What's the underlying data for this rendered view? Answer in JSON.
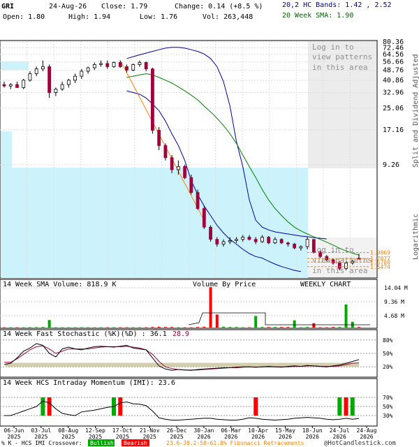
{
  "header": {
    "symbol": "GRI",
    "date": "24-Aug-26",
    "close_label": "Close: 1.79",
    "change_label": "Change: 0.14 (+8.5 %)",
    "open_label": "Open: 1.80",
    "high_label": "High: 1.94",
    "low_label": "Low: 1.76",
    "vol_label": "Vol: 263,448",
    "bands_label": "20,2 HC Bands: 1.42 , 2.52",
    "sma_label": "20 Week SMA: 1.90"
  },
  "watermark": [
    "Log in to",
    "view patterns",
    "in this area"
  ],
  "right_labels": {
    "split": "Split and Dividend Adjusted",
    "log": "Logarithmic"
  },
  "price_ticks": [
    "80.36",
    "72.46",
    "64.56",
    "56.66",
    "48.76",
    "40.86",
    "32.96",
    "25.06",
    "17.16",
    "9.26"
  ],
  "fib_labels": [
    "1.9869",
    "1.7877",
    "1.6760",
    "1.5474"
  ],
  "volume_panel": {
    "title": "14 Week SMA Volume: 818.9 K",
    "vbp": "Volume By Price",
    "weekly": "WEEKLY CHART",
    "ticks": [
      "14.04 M",
      "9.36 M",
      "4.68 M"
    ]
  },
  "stoch_panel": {
    "title": "14 Week Fast Stochastic (%K)(%D) : 36.1",
    "d_value": "28.9",
    "ticks": [
      "80%",
      "50%",
      "20%"
    ]
  },
  "imi_panel": {
    "title": "14 Week HCS Intraday Momentum (IMI): 23.6",
    "ticks": [
      "70%",
      "50%",
      "30%"
    ]
  },
  "x_labels": [
    [
      "06-Jun",
      "2025"
    ],
    [
      "03-Jul",
      "2025"
    ],
    [
      "08-Aug",
      "2025"
    ],
    [
      "12-Sep",
      "2025"
    ],
    [
      "17-Oct",
      "2025"
    ],
    [
      "21-Nov",
      "2025"
    ],
    [
      "26-Dec",
      "2025"
    ],
    [
      "30-Jan",
      "2026"
    ],
    [
      "06-Mar",
      "2026"
    ],
    [
      "10-Apr",
      "2026"
    ],
    [
      "15-May",
      "2026"
    ],
    [
      "18-Jun",
      "2026"
    ],
    [
      "24-Jul",
      "2026"
    ],
    [
      "24-Aug",
      "2026"
    ]
  ],
  "footer": {
    "prefix": "% K - HCS IMI Crossover:",
    "bullish": "Bullish",
    "bearish": "Bearish",
    "fib": "23.6-38.2-50-61.8% Fibonacci Retracements",
    "copyright": "@HotCandlestick.com"
  },
  "colors": {
    "up": "#ffffff",
    "down": "#a0003c",
    "sma": "#008000",
    "bands": "#0000aa",
    "fib": "#ff8000",
    "cyan": "#ccf3fb",
    "vol_red": "#ff0000",
    "vol_green": "#00aa00"
  },
  "chart_data": {
    "type": "candlestick",
    "scale": "log",
    "ylim": [
      1.3,
      80.36
    ],
    "candles": [
      [
        38,
        40,
        36,
        37
      ],
      [
        37,
        39,
        35,
        38
      ],
      [
        38,
        40,
        36,
        36
      ],
      [
        36,
        42,
        35,
        41
      ],
      [
        41,
        48,
        40,
        46
      ],
      [
        46,
        52,
        44,
        50
      ],
      [
        50,
        58,
        48,
        52
      ],
      [
        52,
        54,
        30,
        33
      ],
      [
        33,
        36,
        31,
        35
      ],
      [
        35,
        40,
        34,
        38
      ],
      [
        38,
        42,
        36,
        41
      ],
      [
        41,
        46,
        39,
        44
      ],
      [
        44,
        50,
        42,
        48
      ],
      [
        48,
        52,
        46,
        51
      ],
      [
        51,
        56,
        49,
        54
      ],
      [
        54,
        58,
        52,
        55
      ],
      [
        55,
        58,
        50,
        52
      ],
      [
        52,
        57,
        51,
        56
      ],
      [
        56,
        58,
        51,
        52
      ],
      [
        52,
        54,
        47,
        49
      ],
      [
        49,
        55,
        48,
        54
      ],
      [
        54,
        58,
        52,
        56
      ],
      [
        56,
        57,
        48,
        50
      ],
      [
        50,
        51,
        16,
        17
      ],
      [
        17,
        18,
        12,
        13
      ],
      [
        13,
        13.5,
        10,
        10.5
      ],
      [
        10.5,
        11,
        8,
        8.5
      ],
      [
        8.5,
        10,
        7.8,
        9
      ],
      [
        9,
        9.3,
        7.2,
        7.4
      ],
      [
        7.4,
        7.8,
        5.5,
        5.7
      ],
      [
        5.7,
        6,
        4.2,
        4.3
      ],
      [
        4.3,
        4.5,
        3.0,
        3.1
      ],
      [
        3.1,
        3.2,
        2.4,
        2.5
      ],
      [
        2.5,
        2.6,
        2.2,
        2.3
      ],
      [
        2.3,
        2.5,
        2.2,
        2.4
      ],
      [
        2.4,
        2.6,
        2.3,
        2.45
      ],
      [
        2.45,
        2.6,
        2.35,
        2.5
      ],
      [
        2.5,
        2.7,
        2.4,
        2.6
      ],
      [
        2.6,
        2.7,
        2.45,
        2.5
      ],
      [
        2.5,
        2.6,
        2.3,
        2.4
      ],
      [
        2.4,
        2.7,
        2.35,
        2.6
      ],
      [
        2.6,
        2.65,
        2.3,
        2.35
      ],
      [
        2.35,
        2.6,
        2.3,
        2.5
      ],
      [
        2.5,
        2.55,
        2.3,
        2.35
      ],
      [
        2.35,
        2.4,
        2.2,
        2.3
      ],
      [
        2.3,
        2.35,
        2.1,
        2.15
      ],
      [
        2.15,
        2.25,
        2.05,
        2.2
      ],
      [
        2.2,
        2.6,
        2.1,
        2.5
      ],
      [
        2.5,
        2.5,
        1.95,
        2.0
      ],
      [
        2.0,
        2.05,
        1.8,
        1.85
      ],
      [
        1.85,
        1.9,
        1.7,
        1.75
      ],
      [
        1.75,
        1.8,
        1.6,
        1.65
      ],
      [
        1.65,
        1.7,
        1.45,
        1.5
      ],
      [
        1.5,
        1.7,
        1.45,
        1.65
      ],
      [
        1.65,
        1.75,
        1.6,
        1.7
      ],
      [
        1.8,
        1.94,
        1.76,
        1.79
      ]
    ],
    "sma20": [
      null,
      null,
      null,
      null,
      null,
      null,
      null,
      null,
      null,
      null,
      null,
      null,
      null,
      null,
      null,
      null,
      null,
      null,
      null,
      43,
      44,
      45,
      46,
      45,
      43,
      41,
      39,
      36.5,
      34,
      31.5,
      29,
      26,
      23.5,
      21,
      18.5,
      16,
      13.5,
      11,
      9,
      7.4,
      6,
      5,
      4.3,
      3.8,
      3.4,
      3.1,
      2.9,
      2.75,
      2.62,
      2.5,
      2.38,
      2.26,
      2.14,
      2.04,
      1.96,
      1.9
    ],
    "upper_band": [
      null,
      null,
      null,
      null,
      null,
      null,
      null,
      null,
      null,
      null,
      null,
      null,
      null,
      null,
      null,
      null,
      null,
      null,
      null,
      60,
      62,
      64,
      66,
      68,
      70,
      72,
      73,
      73,
      72,
      70,
      68,
      65,
      60,
      52,
      40,
      26,
      14,
      9,
      5,
      3.5,
      3.1,
      2.95,
      2.85,
      2.8,
      2.75,
      2.7,
      2.65,
      2.62,
      2.58,
      2.55,
      2.52
    ],
    "lower_band": [
      null,
      null,
      null,
      null,
      null,
      null,
      null,
      null,
      null,
      null,
      null,
      null,
      null,
      null,
      null,
      null,
      null,
      null,
      null,
      34,
      33,
      32,
      30,
      27,
      24,
      20,
      16,
      13,
      10,
      7,
      5.5,
      4.5,
      3.8,
      3.2,
      2.8,
      2.5,
      2.3,
      2.1,
      1.95,
      1.85,
      1.8,
      1.7,
      1.62,
      1.55,
      1.5,
      1.45,
      1.42
    ],
    "volume_red_weeks": [
      39,
      40,
      41,
      48
    ],
    "volume_green_weeks": [
      52,
      53
    ],
    "stoch_k": [
      25,
      28,
      40,
      55,
      62,
      72,
      68,
      50,
      42,
      60,
      64,
      60,
      58,
      62,
      65,
      66,
      65,
      64,
      66,
      68,
      62,
      60,
      58,
      40,
      22,
      15,
      12,
      14,
      13,
      12,
      14,
      15,
      16,
      17,
      18,
      18,
      19,
      20,
      20,
      19,
      20,
      21,
      20,
      19,
      21,
      22,
      21,
      23,
      22,
      21,
      20,
      22,
      24,
      28,
      32,
      36.1
    ],
    "stoch_d": [
      30,
      30,
      38,
      48,
      58,
      65,
      67,
      60,
      50,
      55,
      60,
      60,
      60,
      60,
      62,
      64,
      65,
      65,
      65,
      66,
      64,
      62,
      58,
      48,
      32,
      20,
      16,
      14,
      13,
      13,
      13,
      14,
      15,
      16,
      17,
      18,
      18,
      19,
      20,
      19,
      20,
      20,
      20,
      20,
      20,
      21,
      21,
      22,
      22,
      21,
      21,
      21,
      22,
      25,
      28,
      28.9
    ],
    "imi": [
      30,
      30,
      35,
      40,
      45,
      50,
      62,
      58,
      45,
      35,
      32,
      30,
      38,
      40,
      42,
      45,
      48,
      50,
      58,
      60,
      56,
      55,
      52,
      40,
      25,
      22,
      20,
      20,
      21,
      22,
      23,
      24,
      24,
      22,
      21,
      20,
      20,
      22,
      25,
      24,
      22,
      21,
      20,
      21,
      22,
      24,
      25,
      26,
      25,
      24,
      22,
      21,
      22,
      24,
      22,
      23.6
    ]
  }
}
